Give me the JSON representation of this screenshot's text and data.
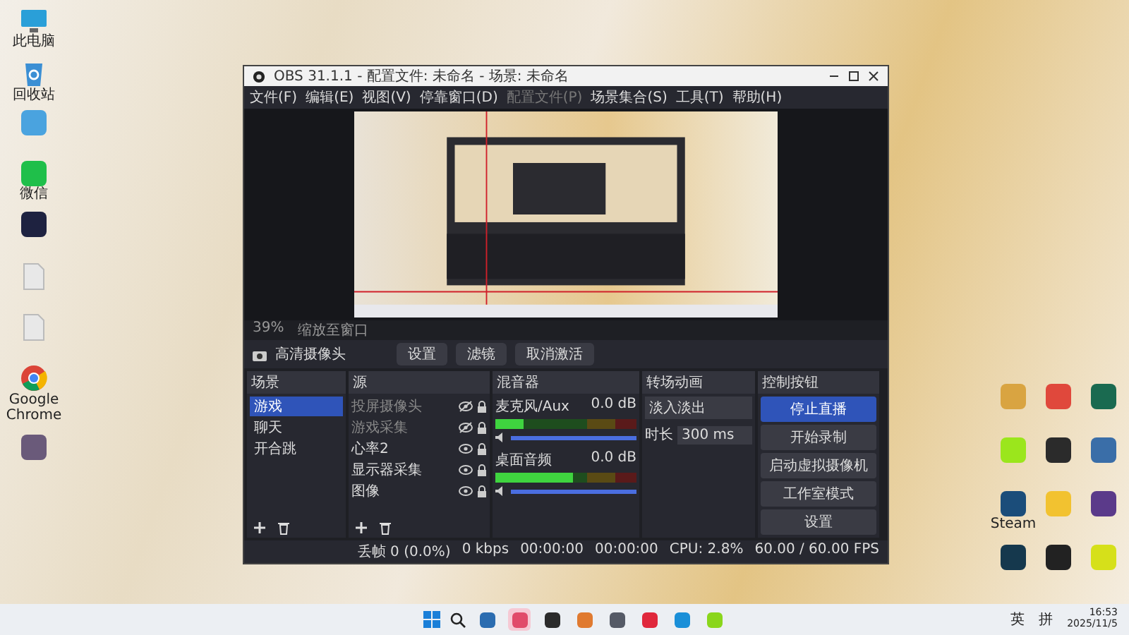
{
  "desktop_icons": [
    {
      "kind": "monitor",
      "color": "#2a9fd8",
      "label": "此电脑"
    },
    {
      "kind": "recycle",
      "color": "#3b8fd4",
      "label": "回收站"
    },
    {
      "kind": "app",
      "color": "#4aa3df"
    },
    {
      "kind": "app",
      "color": "#1fbf4a",
      "label": "微信"
    },
    {
      "kind": "app",
      "color": "#1e2240"
    },
    {
      "kind": "file",
      "color": "#e8e8e8"
    },
    {
      "kind": "file",
      "color": "#e8e8e8"
    },
    {
      "kind": "chrome",
      "color": "#db4437",
      "label": "Google Chrome"
    },
    {
      "kind": "app",
      "color": "#6a5a7a"
    }
  ],
  "right_icons": [
    {
      "color": "#d9a441"
    },
    {
      "color": "#e0483c"
    },
    {
      "color": "#1a6a50"
    },
    {
      "color": "#9be61c"
    },
    {
      "color": "#2b2b2b"
    },
    {
      "color": "#3a6ea8"
    },
    {
      "color": "#1b4d7a",
      "label": "Steam"
    },
    {
      "color": "#f2c230"
    },
    {
      "color": "#5b3a8a"
    },
    {
      "color": "#15384d"
    },
    {
      "color": "#222222"
    },
    {
      "color": "#d6e01a"
    }
  ],
  "window": {
    "title": "OBS 31.1.1 - 配置文件: 未命名 - 场景: 未命名"
  },
  "menu": [
    {
      "label": "文件(F)",
      "disabled": false
    },
    {
      "label": "编辑(E)",
      "disabled": false
    },
    {
      "label": "视图(V)",
      "disabled": false
    },
    {
      "label": "停靠窗口(D)",
      "disabled": false
    },
    {
      "label": "配置文件(P)",
      "disabled": true
    },
    {
      "label": "场景集合(S)",
      "disabled": false
    },
    {
      "label": "工具(T)",
      "disabled": false
    },
    {
      "label": "帮助(H)",
      "disabled": false
    }
  ],
  "preview_toolbar": {
    "zoom": "39%",
    "mode": "缩放至窗口"
  },
  "source_toolbar": {
    "source": "高清摄像头",
    "buttons": [
      "设置",
      "滤镜",
      "取消激活"
    ]
  },
  "scenes": {
    "title": "场景",
    "items": [
      {
        "label": "游戏",
        "selected": true
      },
      {
        "label": "聊天",
        "selected": false
      },
      {
        "label": "开合跳",
        "selected": false
      }
    ]
  },
  "sources": {
    "title": "源",
    "items": [
      {
        "label": "投屏摄像头",
        "visible": false
      },
      {
        "label": "游戏采集",
        "visible": false
      },
      {
        "label": "心率2",
        "visible": true
      },
      {
        "label": "显示器采集",
        "visible": true
      },
      {
        "label": "图像",
        "visible": true
      }
    ]
  },
  "mixer": {
    "title": "混音器",
    "channels": [
      {
        "name": "麦克风/Aux",
        "reading": "0.0 dB",
        "level": 0.2,
        "volume": {
          "level": 1
        }
      },
      {
        "name": "桌面音频",
        "reading": "0.0 dB",
        "level": 0.55,
        "volume": {
          "level": 1
        }
      }
    ]
  },
  "transitions": {
    "title": "转场动画",
    "value": "淡入淡出",
    "duration_label": "时长",
    "duration": "300 ms"
  },
  "controls": {
    "title": "控制按钮",
    "buttons": [
      {
        "label": "停止直播",
        "active": true
      },
      {
        "label": "开始录制",
        "active": false
      },
      {
        "label": "启动虚拟摄像机",
        "active": false
      },
      {
        "label": "工作室模式",
        "active": false
      },
      {
        "label": "设置",
        "active": false
      }
    ]
  },
  "status_bar": [
    "丢帧 0 (0.0%)",
    "0 kbps",
    "00:00:00",
    "00:00:00",
    "CPU: 2.8%",
    "60.00 / 60.00 FPS"
  ],
  "taskbar": {
    "icons": [
      {
        "color": "#2b6cb0",
        "selected": false
      },
      {
        "color": "#e14b6a",
        "selected": true
      },
      {
        "color": "#2b2b2b",
        "selected": false
      },
      {
        "color": "#e07a30",
        "selected": false
      },
      {
        "color": "#555a66",
        "selected": false
      },
      {
        "color": "#e0283c",
        "selected": false
      },
      {
        "color": "#1a8fd8",
        "selected": false
      },
      {
        "color": "#8ad61c",
        "selected": false
      }
    ],
    "ime_lang": "英",
    "ime_mode": "拼",
    "time": "16:53",
    "date": "2025/11/5"
  }
}
